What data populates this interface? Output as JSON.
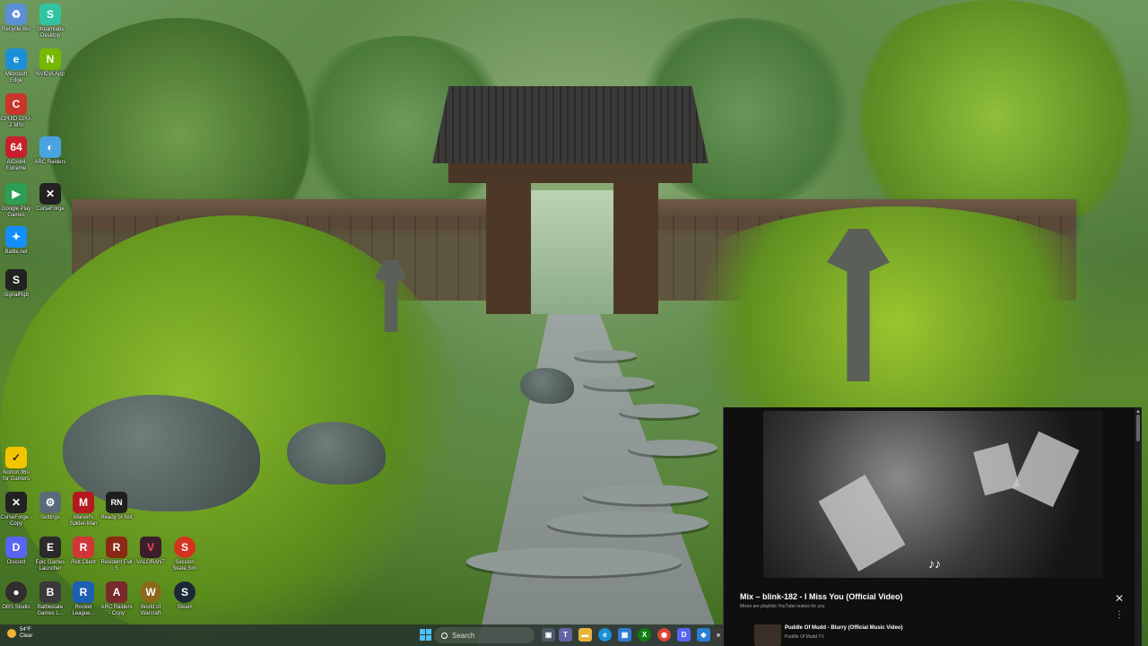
{
  "desktop": {
    "icons": [
      {
        "label": "Recycle Bin",
        "glyph": "♻",
        "color": "#5b8fd6"
      },
      {
        "label": "Streamlabs Desktop",
        "glyph": "S",
        "color": "#31c3a2"
      },
      {
        "label": "Microsoft Edge",
        "glyph": "e",
        "color": "#1a8fd6"
      },
      {
        "label": "NVIDIA App",
        "glyph": "N",
        "color": "#76b900"
      },
      {
        "label": "CPUID CPU-Z MSI",
        "glyph": "C",
        "color": "#c8352b"
      },
      {
        "label": "AIDA64 Extreme",
        "glyph": "64",
        "color": "#c8202a"
      },
      {
        "label": "ARC Raiders",
        "glyph": "◐",
        "color": "#4aa3e0"
      },
      {
        "label": "Google Play Games",
        "glyph": "▶",
        "color": "#2c9f55"
      },
      {
        "label": "CurseForge",
        "glyph": "✕",
        "color": "#222222"
      },
      {
        "label": "Battle.net",
        "glyph": "✦",
        "color": "#148eff"
      },
      {
        "label": "SignalRgb",
        "glyph": "S",
        "color": "#222222"
      },
      {
        "label": "Norton 360 for Gamers",
        "glyph": "✓",
        "color": "#f5c400"
      },
      {
        "label": "CurseForge - Copy",
        "glyph": "✕",
        "color": "#222222"
      },
      {
        "label": "Settings",
        "glyph": "⚙",
        "color": "#5a6a7a"
      },
      {
        "label": "Marvel's Spider-Man",
        "glyph": "M",
        "color": "#b5191f"
      },
      {
        "label": "Ready or Not",
        "glyph": "RN",
        "color": "#1f1f1f"
      },
      {
        "label": "Discord",
        "glyph": "D",
        "color": "#5865f2"
      },
      {
        "label": "Epic Games Launcher",
        "glyph": "E",
        "color": "#2a2a2a"
      },
      {
        "label": "Riot Client",
        "glyph": "R",
        "color": "#d13639"
      },
      {
        "label": "Resident Evil 5",
        "glyph": "R",
        "color": "#8a2a14"
      },
      {
        "label": "VALORANT",
        "glyph": "V",
        "color": "#3a1f2a"
      },
      {
        "label": "Session Skate Sim",
        "glyph": "S",
        "color": "#d6331f"
      },
      {
        "label": "OBS Studio",
        "glyph": "●",
        "color": "#302e31"
      },
      {
        "label": "Battlestate Games L...",
        "glyph": "B",
        "color": "#3a3a3a"
      },
      {
        "label": "Rocket League...",
        "glyph": "R",
        "color": "#1e5fb4"
      },
      {
        "label": "ARC Raiders - Copy",
        "glyph": "A",
        "color": "#7a2a2a"
      },
      {
        "label": "World of Warcraft",
        "glyph": "W",
        "color": "#8a6a1a"
      },
      {
        "label": "Steam",
        "glyph": "S",
        "color": "#1b2838"
      }
    ]
  },
  "miniplayer": {
    "title": "Mix – blink-182 - I Miss You (Official Video)",
    "subtitle": "Mixes are playlists YouTube makes for you",
    "close_glyph": "✕",
    "more_glyph": "⋮",
    "notes_glyph": "♪♪",
    "next_title": "Puddle Of Mudd - Blurry (Official Music Video)",
    "next_channel": "Puddle Of Mudd TV",
    "scroll_up": "▲"
  },
  "taskbar": {
    "weather_temp": "54°F",
    "weather_desc": "Clear",
    "search_placeholder": "Search",
    "apps": [
      {
        "name": "task-view",
        "glyph": "▣",
        "color": "#4a5a66"
      },
      {
        "name": "teams",
        "glyph": "T",
        "color": "#6264a7"
      },
      {
        "name": "file-explorer",
        "glyph": "▬",
        "color": "#e8b53a"
      },
      {
        "name": "edge",
        "glyph": "e",
        "color": "#1a8fd6"
      },
      {
        "name": "store",
        "glyph": "▦",
        "color": "#2f7bd6"
      },
      {
        "name": "xbox",
        "glyph": "X",
        "color": "#107c10"
      },
      {
        "name": "chrome",
        "glyph": "◉",
        "color": "#db4437"
      },
      {
        "name": "discord",
        "glyph": "D",
        "color": "#5865f2"
      },
      {
        "name": "photos",
        "glyph": "◆",
        "color": "#2a7fd6"
      },
      {
        "name": "more",
        "glyph": "»",
        "color": "#3b3b3b"
      }
    ]
  }
}
